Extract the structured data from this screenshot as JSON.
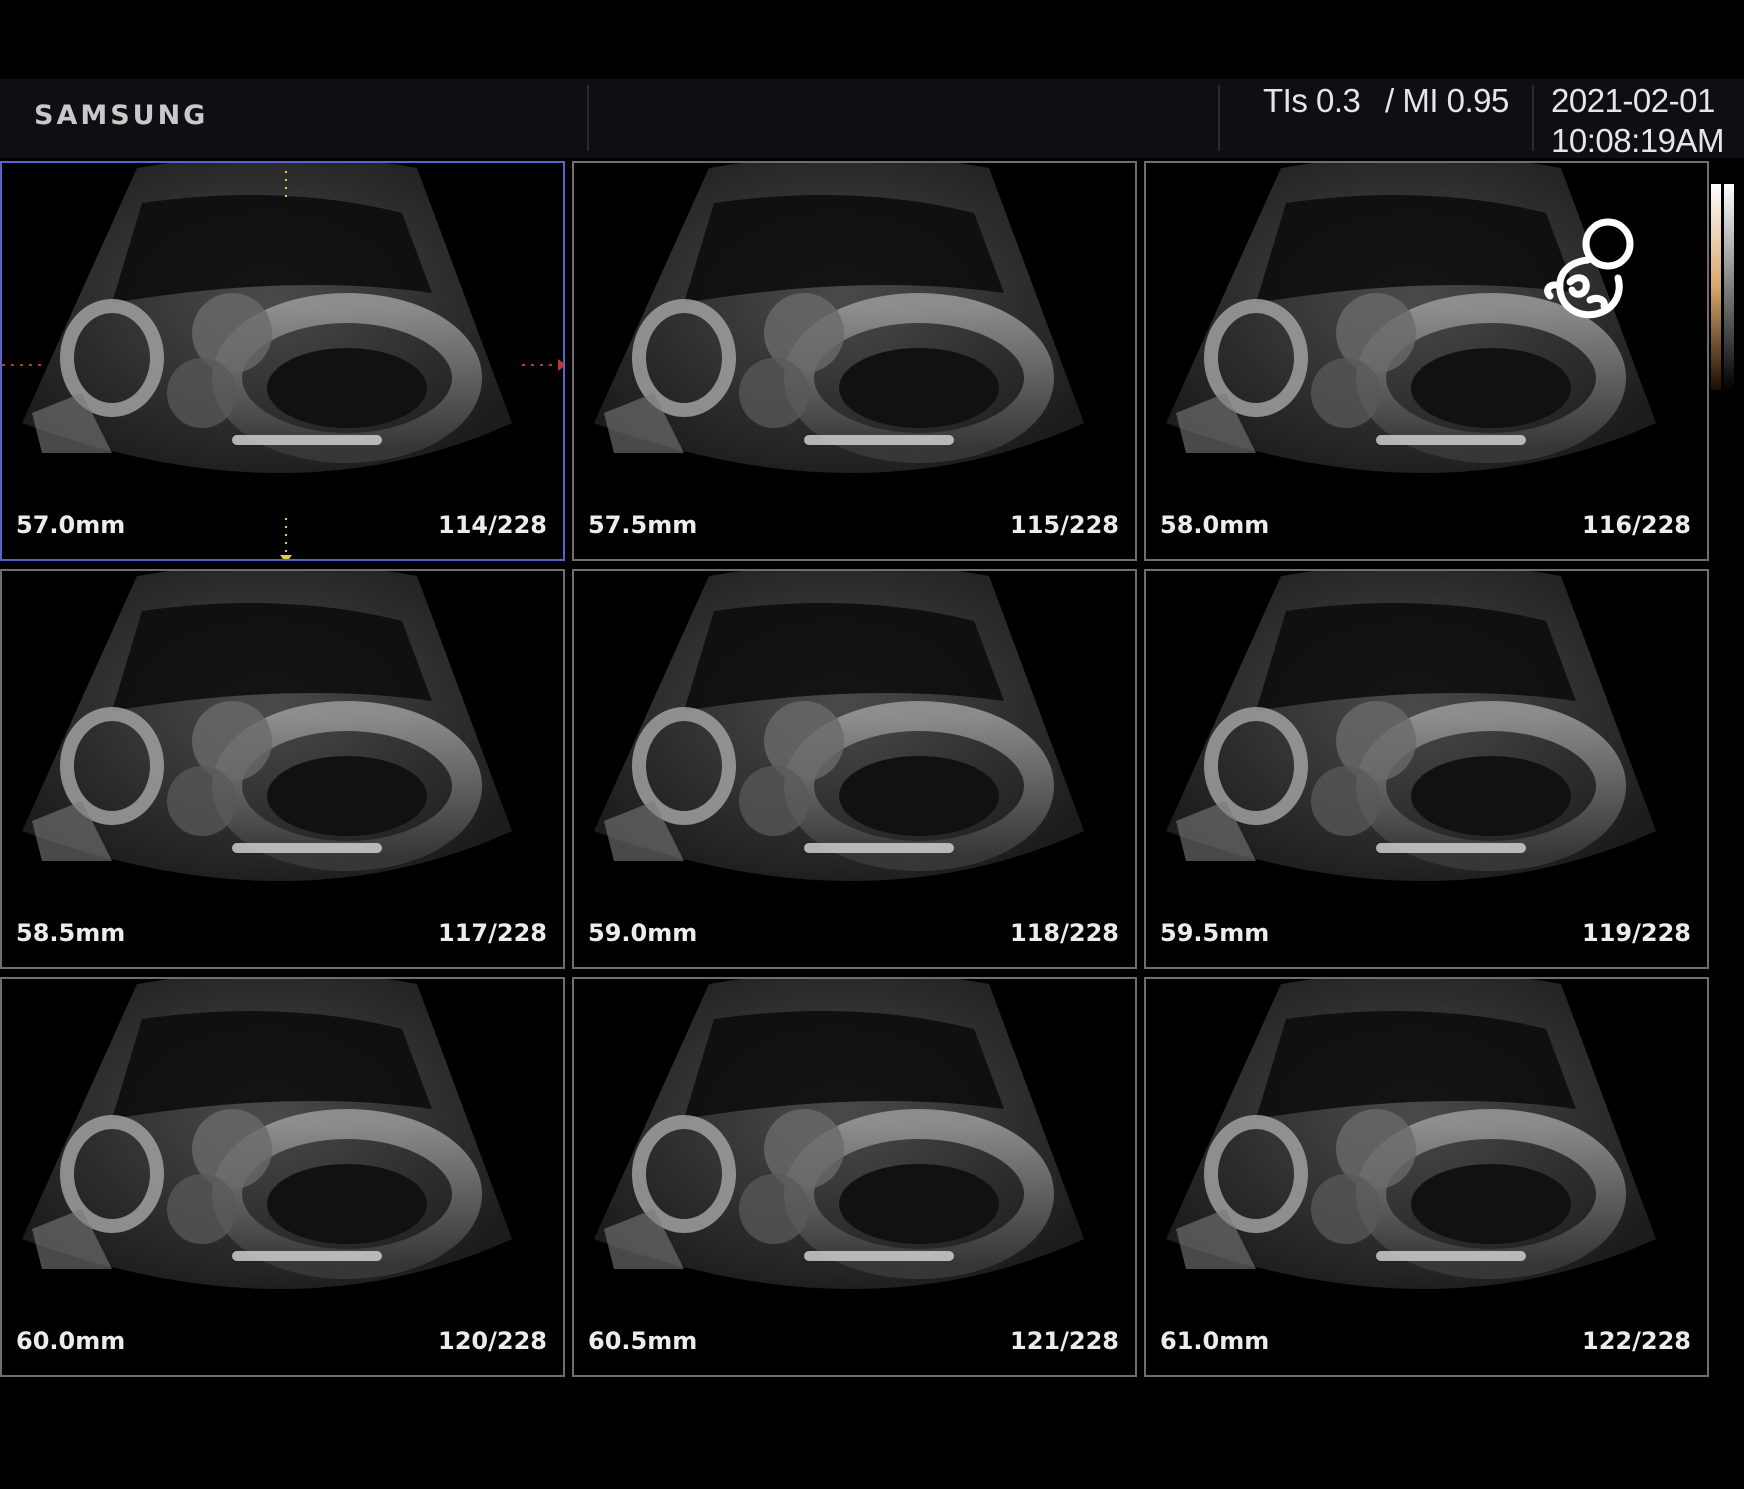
{
  "header": {
    "brand": "SAMSUNG",
    "tis": "TIs 0.3",
    "mi": "/ MI 0.95",
    "date": "2021-02-01",
    "time": "10:08:19AM"
  },
  "tiles": [
    {
      "depth": "57.0mm",
      "frame": "114/228",
      "active": true
    },
    {
      "depth": "57.5mm",
      "frame": "115/228"
    },
    {
      "depth": "58.0mm",
      "frame": "116/228"
    },
    {
      "depth": "58.5mm",
      "frame": "117/228"
    },
    {
      "depth": "59.0mm",
      "frame": "118/228"
    },
    {
      "depth": "59.5mm",
      "frame": "119/228"
    },
    {
      "depth": "60.0mm",
      "frame": "120/228"
    },
    {
      "depth": "60.5mm",
      "frame": "121/228"
    },
    {
      "depth": "61.0mm",
      "frame": "122/228"
    }
  ],
  "icons": {
    "fetus": "fetus-icon",
    "colorbar": "grayscale-map"
  },
  "colors": {
    "active_border": "#5c62c8",
    "tile_border": "#6e6e6e",
    "marker_yellow": "#e8c84a",
    "marker_red": "#c0392b"
  }
}
